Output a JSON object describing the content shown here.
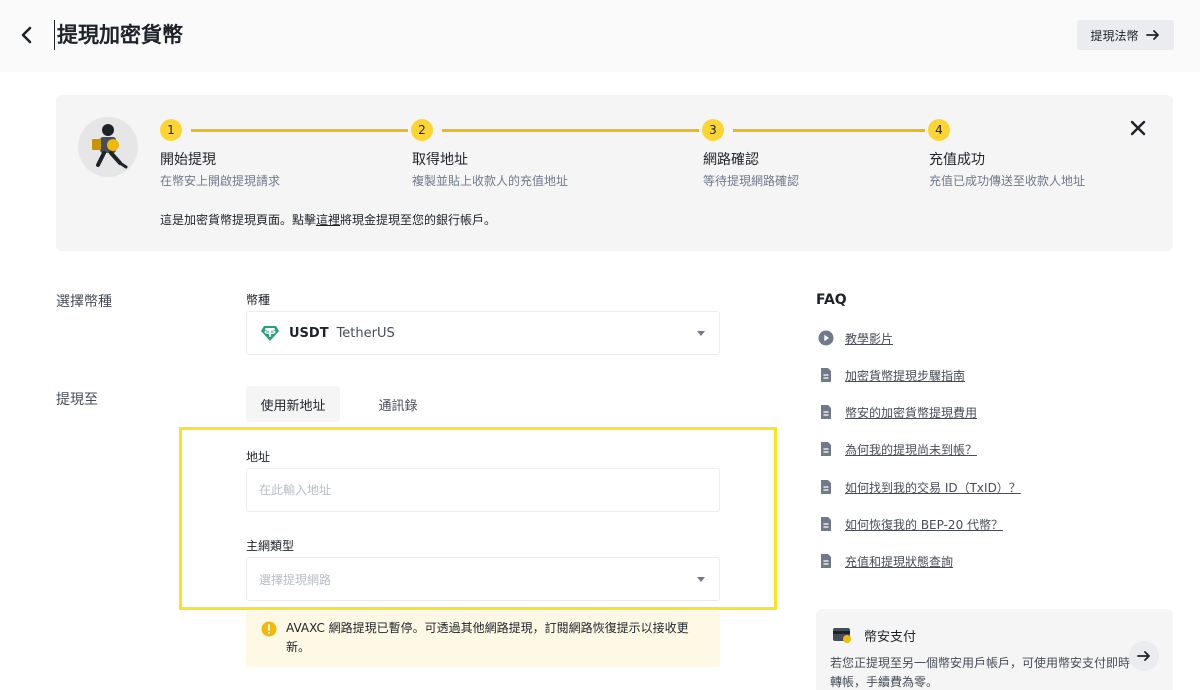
{
  "header": {
    "title": "提現加密貨幣",
    "fiat_button": "提現法幣"
  },
  "guide": {
    "steps": [
      {
        "num": "1",
        "title": "開始提現",
        "desc": "在幣安上開啟提現請求"
      },
      {
        "num": "2",
        "title": "取得地址",
        "desc": "複製並貼上收款人的充值地址"
      },
      {
        "num": "3",
        "title": "網路確認",
        "desc": "等待提現網路確認"
      },
      {
        "num": "4",
        "title": "充值成功",
        "desc": "充值已成功傳送至收款人地址"
      }
    ],
    "note_before": "這是加密貨幣提現頁面。點擊",
    "note_link": "這裡",
    "note_after": "將現金提現至您的銀行帳戶。"
  },
  "form": {
    "coin_section": "選擇幣種",
    "coin_label": "幣種",
    "coin_symbol": "USDT",
    "coin_name": "TetherUS",
    "withdraw_to_section": "提現至",
    "tab_new_address": "使用新地址",
    "tab_address_book": "通訊錄",
    "address_label": "地址",
    "address_placeholder": "在此輸入地址",
    "network_label": "主網類型",
    "network_placeholder": "選擇提現網路",
    "warning": "AVAXC 網路提現已暫停。可透過其他網路提現，訂閱網路恢復提示以接收更新。"
  },
  "faq": {
    "title": "FAQ",
    "items": [
      {
        "icon": "play-icon",
        "label": "教學影片"
      },
      {
        "icon": "document-icon",
        "label": "加密貨幣提現步驟指南"
      },
      {
        "icon": "document-icon",
        "label": "幣安的加密貨幣提現費用"
      },
      {
        "icon": "document-icon",
        "label": "為何我的提現尚未到帳？"
      },
      {
        "icon": "document-icon",
        "label": "如何找到我的交易 ID（TxID）？"
      },
      {
        "icon": "document-icon",
        "label": "如何恢復我的 BEP-20 代幣？"
      },
      {
        "icon": "document-icon",
        "label": "充值和提現狀態查詢"
      }
    ]
  },
  "pay_card": {
    "title": "幣安支付",
    "desc": "若您正提現至另一個幣安用戶帳戶，可使用幣安支付即時轉帳，手續費為零。"
  },
  "colors": {
    "accent": "#fcd535",
    "line": "#f0b90b",
    "highlight": "#f7e61d",
    "tether": "#26a17b"
  }
}
